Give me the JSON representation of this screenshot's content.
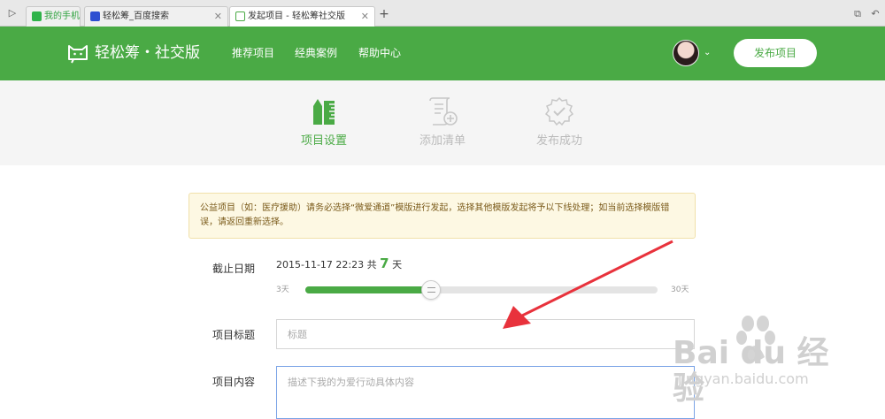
{
  "browser": {
    "tabs": [
      {
        "label": "我的手机"
      },
      {
        "label": "轻松筹_百度搜索"
      },
      {
        "label": "发起项目 - 轻松筹社交版"
      }
    ]
  },
  "header": {
    "logo": "轻松筹・社交版",
    "nav": [
      "推荐项目",
      "经典案例",
      "帮助中心"
    ],
    "publish_label": "发布项目"
  },
  "steps": [
    {
      "label": "项目设置",
      "icon": "ruler-pencil-icon",
      "active": true
    },
    {
      "label": "添加清单",
      "icon": "scroll-add-icon",
      "active": false
    },
    {
      "label": "发布成功",
      "icon": "check-badge-icon",
      "active": false
    }
  ],
  "notice": "公益项目（如：医疗援助）请务必选择“微爱通道”模版进行发起，选择其他模版发起将予以下线处理；如当前选择模版错误，请返回重新选择。",
  "form": {
    "deadline_label": "截止日期",
    "deadline_value": "2015-11-17 22:23",
    "deadline_total_prefix": "共",
    "deadline_days": "7",
    "deadline_unit": "天",
    "slider_min": "3天",
    "slider_max": "30天",
    "slider_value_days": 7,
    "slider_range_days": [
      3,
      30
    ],
    "title_label": "项目标题",
    "title_placeholder": "标题",
    "content_label": "项目内容",
    "content_placeholder": "描述下我的为爱行动具体内容"
  },
  "watermark": {
    "brand": "Bai du 经验",
    "url": "jingyan.baidu.com"
  },
  "colors": {
    "brand_green": "#4aaa45",
    "arrow_red": "#e8323c"
  }
}
